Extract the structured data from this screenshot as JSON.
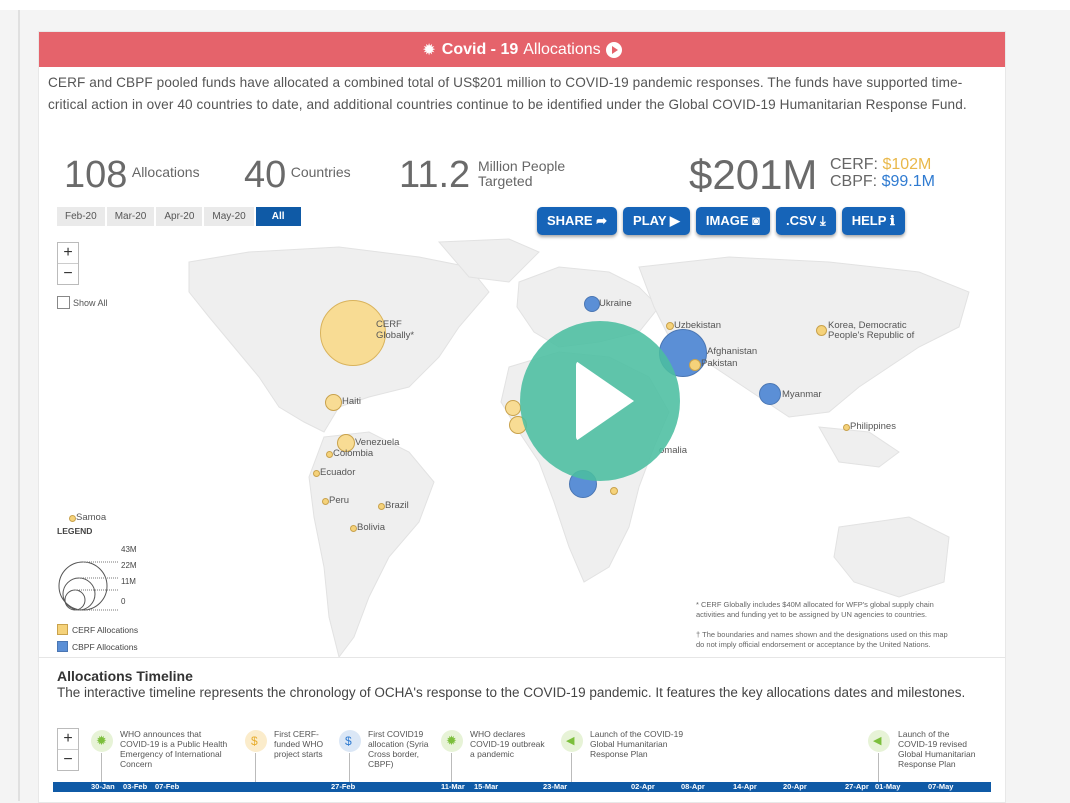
{
  "title": {
    "bold": "Covid - 19",
    "rest": "Allocations"
  },
  "intro": "CERF and CBPF pooled funds have allocated a combined total of US$201 million to COVID-19 pandemic responses. The funds have supported time-critical action in over 40 countries to date, and additional countries continue to be identified under the Global COVID-19 Humanitarian Response Fund.",
  "stats": {
    "allocations": {
      "value": "108",
      "label": "Allocations"
    },
    "countries": {
      "value": "40",
      "label": "Countries"
    },
    "people": {
      "value": "11.2",
      "label1": "Million People",
      "label2": "Targeted"
    },
    "total": {
      "value": "$201M"
    },
    "cerf": {
      "label": "CERF:",
      "value": "$102M"
    },
    "cbpf": {
      "label": "CBPF:",
      "value": "$99.1M"
    }
  },
  "date_filters": [
    "Feb-20",
    "Mar-20",
    "Apr-20",
    "May-20",
    "All"
  ],
  "active_filter": "All",
  "actions": {
    "share": "SHARE",
    "play": "PLAY",
    "image": "IMAGE",
    "csv": ".CSV",
    "help": "HELP"
  },
  "zoom": {
    "plus": "+",
    "minus": "−"
  },
  "show_all": "Show All",
  "map_labels": {
    "cerf_globally_1": "CERF",
    "cerf_globally_2": "Globally*",
    "ukraine": "Ukraine",
    "uzbekistan": "Uzbekistan",
    "afghanistan": "Afghanistan",
    "pakistan": "Pakistan",
    "korea_1": "Korea, Democratic",
    "korea_2": "People's Republic of",
    "myanmar": "Myanmar",
    "philippines": "Philippines",
    "somalia": "omalia",
    "haiti": "Haiti",
    "venezuela": "Venezuela",
    "colombia": "Colombia",
    "ecuador": "Ecuador",
    "peru": "Peru",
    "brazil": "Brazil",
    "bolivia": "Bolivia",
    "samoa": "Samoa"
  },
  "legend": {
    "title": "LEGEND",
    "sizes": [
      "43M",
      "22M",
      "11M",
      "0"
    ],
    "cerf": "CERF Allocations",
    "cbpf": "CBPF Allocations"
  },
  "colors": {
    "cerf": "#f5d27a",
    "cbpf": "#5b8fd6",
    "title_bar": "#e5636b",
    "button": "#1664b8",
    "play_overlay": "#4bbea0"
  },
  "notes": {
    "note1_1": "* CERF Globally includes $40M allocated for WFP's global supply chain",
    "note1_2": "activities and funding yet to be assigned by UN agencies to countries.",
    "note2_1": "† The boundaries and names shown and the designations used on this map",
    "note2_2": "do not imply official endorsement or acceptance by the United Nations."
  },
  "timeline": {
    "title": "Allocations Timeline",
    "description": "The interactive timeline represents the chronology of OCHA's response to the COVID-19 pandemic. It features the key allocations dates and milestones.",
    "events": [
      {
        "l1": "WHO announces that",
        "l2": "COVID-19 is a Public Health",
        "l3": "Emergency of International",
        "l4": "Concern"
      },
      {
        "l1": "First CERF-",
        "l2": "funded WHO",
        "l3": "project starts",
        "l4": ""
      },
      {
        "l1": "First COVID19",
        "l2": "allocation (Syria",
        "l3": "Cross border,",
        "l4": "CBPF)"
      },
      {
        "l1": "WHO declares",
        "l2": "COVID-19 outbreak",
        "l3": "a pandemic",
        "l4": ""
      },
      {
        "l1": "Launch of the COVID-19",
        "l2": "Global Humanitarian",
        "l3": "Response Plan",
        "l4": ""
      },
      {
        "l1": "Launch of the",
        "l2": "COVID-19 revised",
        "l3": "Global Humanitarian",
        "l4": "Response Plan"
      }
    ],
    "dates": [
      "30-Jan",
      "03-Feb",
      "07-Feb",
      "27-Feb",
      "11-Mar",
      "15-Mar",
      "23-Mar",
      "02-Apr",
      "08-Apr",
      "14-Apr",
      "20-Apr",
      "27-Apr",
      "01-May",
      "07-May"
    ]
  }
}
